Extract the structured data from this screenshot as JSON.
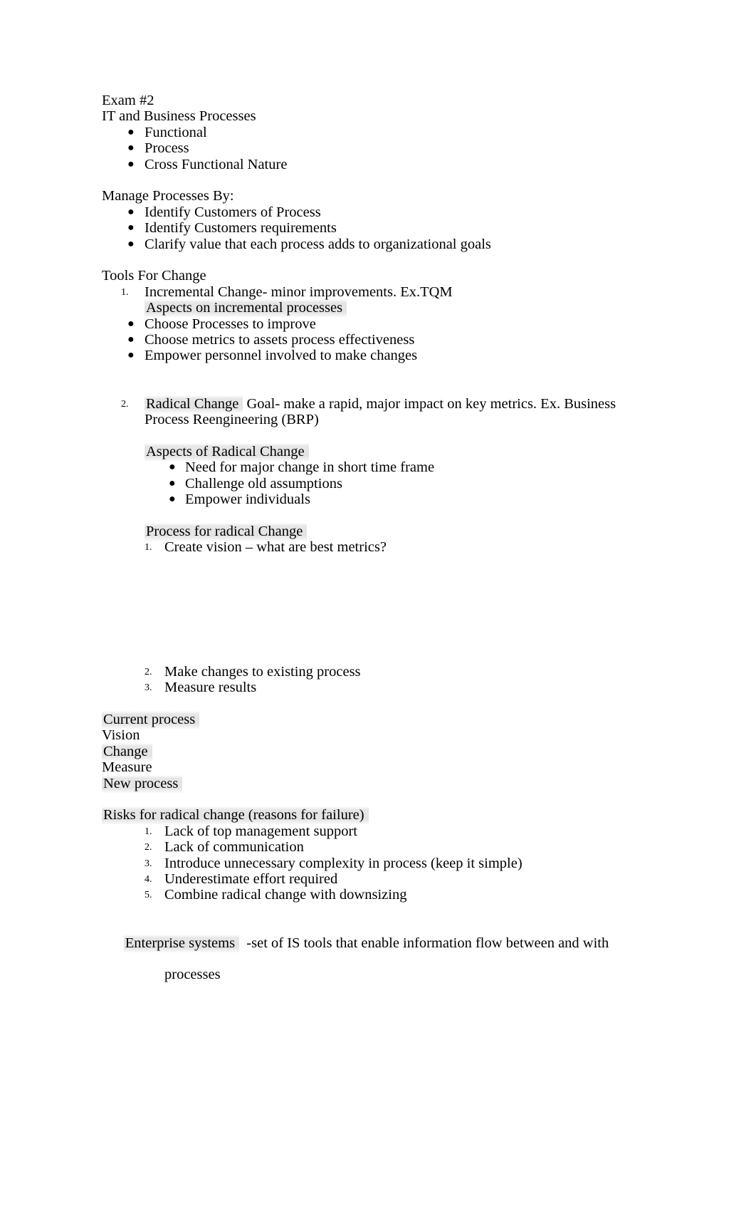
{
  "document": {
    "title": "Exam #2",
    "sections": {
      "intro": {
        "heading": "IT and Business Processes",
        "bullets": [
          "Functional",
          "Process",
          "Cross Functional Nature"
        ]
      },
      "manage": {
        "heading": "Manage Processes By:",
        "bullets": [
          "Identify Customers of Process",
          "Identify Customers requirements",
          "Clarify value that each process adds to organizational goals"
        ]
      },
      "tools": {
        "heading": "Tools For Change",
        "item1": {
          "marker": "1.",
          "text": "Incremental Change- minor improvements. Ex.TQM",
          "subheading": "Aspects on incremental processes",
          "bullets": [
            "Choose Processes to improve",
            "Choose metrics to assets process effectiveness",
            "Empower personnel involved to make changes"
          ]
        },
        "item2": {
          "marker": "2.",
          "label": "Radical Change",
          "text_after_label": "  Goal- make a rapid, major impact on key metrics. Ex. Business",
          "text_line2": "Process Reengineering (BRP)",
          "aspects_heading": "Aspects of Radical Change",
          "aspects_bullets": [
            "Need for major change in short time frame",
            "Challenge old assumptions",
            "Empower individuals"
          ],
          "process_heading": "Process for radical Change",
          "process_steps": [
            {
              "marker": "1.",
              "text": "Create vision – what are best metrics?"
            },
            {
              "marker": "2.",
              "text": "Make changes to existing process"
            },
            {
              "marker": "3.",
              "text": "Measure results"
            }
          ]
        }
      },
      "cycle": {
        "lines": [
          "Current process",
          "Vision",
          "Change",
          "Measure",
          "New process"
        ]
      },
      "risks": {
        "heading": "Risks for radical change (reasons for failure)",
        "items": [
          {
            "marker": "1.",
            "text": "Lack of top management support"
          },
          {
            "marker": "2.",
            "text": "Lack of communication"
          },
          {
            "marker": "3.",
            "text": "Introduce unnecessary complexity in process (keep it simple)"
          },
          {
            "marker": "4.",
            "text": "Underestimate effort required"
          },
          {
            "marker": "5.",
            "text": "Combine radical change with downsizing"
          }
        ]
      },
      "enterprise": {
        "label": "Enterprise systems",
        "text": "  -set of IS tools that enable information flow between and with",
        "wrap": "processes"
      }
    }
  }
}
